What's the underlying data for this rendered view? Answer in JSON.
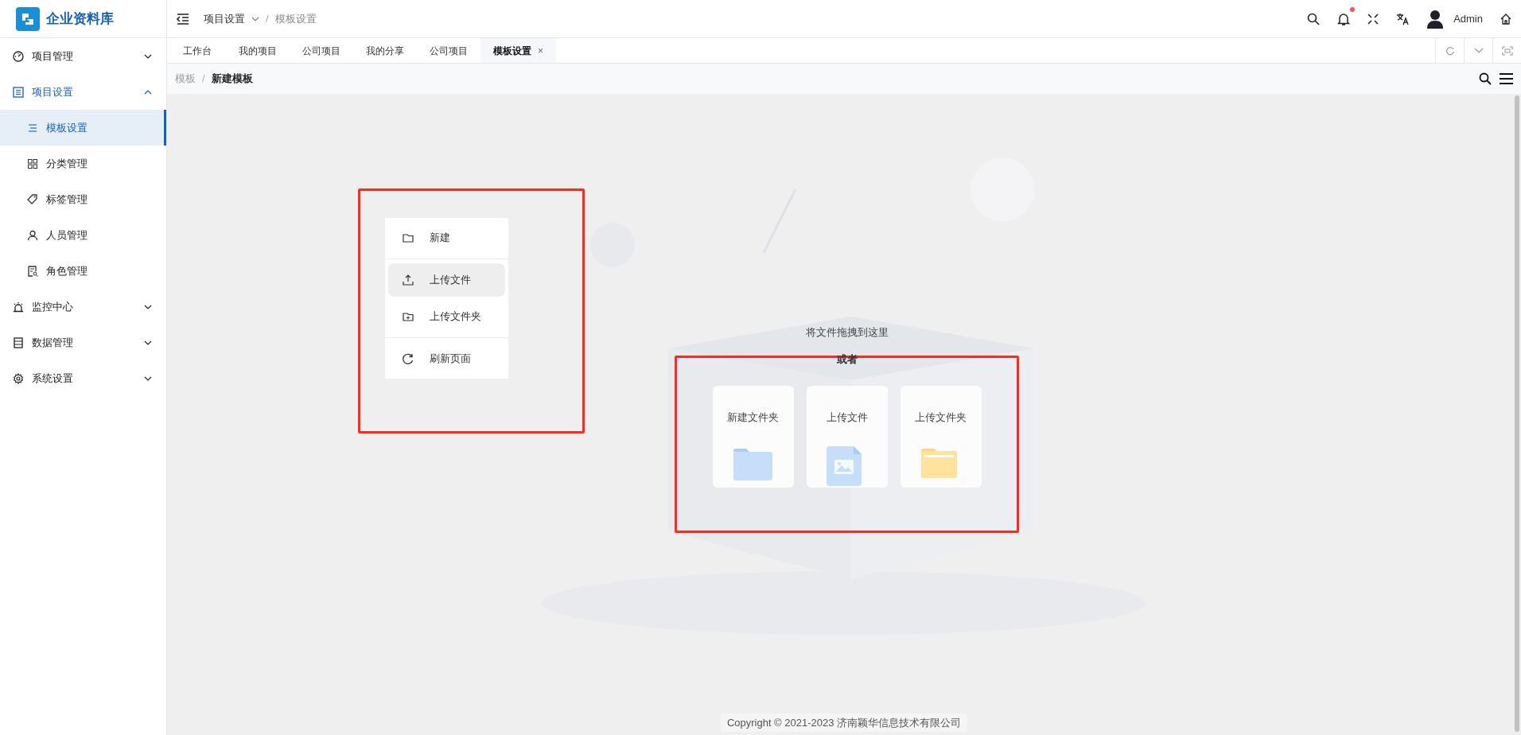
{
  "app": {
    "title": "企业资料库"
  },
  "header": {
    "breadcrumb": {
      "separator": "/",
      "items": [
        {
          "label": "项目设置",
          "dropdown": true
        },
        {
          "label": "模板设置",
          "dropdown": false
        }
      ]
    },
    "notification_dot": true,
    "user": "Admin"
  },
  "sidebar": {
    "items": [
      {
        "label": "项目管理",
        "expanded": false,
        "selected": false
      },
      {
        "label": "项目设置",
        "expanded": true,
        "selected": true,
        "children": [
          {
            "label": "模板设置",
            "selected": true
          },
          {
            "label": "分类管理",
            "selected": false
          },
          {
            "label": "标签管理",
            "selected": false
          },
          {
            "label": "人员管理",
            "selected": false
          },
          {
            "label": "角色管理",
            "selected": false
          }
        ]
      },
      {
        "label": "监控中心",
        "expanded": false,
        "selected": false
      },
      {
        "label": "数据管理",
        "expanded": false,
        "selected": false
      },
      {
        "label": "系统设置",
        "expanded": false,
        "selected": false
      }
    ]
  },
  "tabs": [
    {
      "label": "工作台",
      "selected": false
    },
    {
      "label": "我的项目",
      "selected": false
    },
    {
      "label": "公司项目",
      "selected": false
    },
    {
      "label": "我的分享",
      "selected": false
    },
    {
      "label": "公司项目",
      "selected": false
    },
    {
      "label": "模板设置",
      "selected": true,
      "close": "×"
    }
  ],
  "page_breadcrumb": {
    "separator": "/",
    "items": [
      {
        "label": "模板",
        "current": false
      },
      {
        "label": "新建模板",
        "current": true
      }
    ]
  },
  "context_menu": {
    "groups": [
      [
        {
          "label": "新建",
          "hovered": false
        }
      ],
      [
        {
          "label": "上传文件",
          "hovered": true
        },
        {
          "label": "上传文件夹",
          "hovered": false
        }
      ],
      [
        {
          "label": "刷新页面",
          "hovered": false
        }
      ]
    ]
  },
  "drop_zone": {
    "hint": "将文件拖拽到这里",
    "or": "或者",
    "cards": [
      {
        "label": "新建文件夹",
        "kind": "folder-blue"
      },
      {
        "label": "上传文件",
        "kind": "image-file"
      },
      {
        "label": "上传文件夹",
        "kind": "folder-yellow"
      }
    ]
  },
  "footer": {
    "copyright": "Copyright © 2021-2023 济南颖华信息技术有限公司"
  }
}
